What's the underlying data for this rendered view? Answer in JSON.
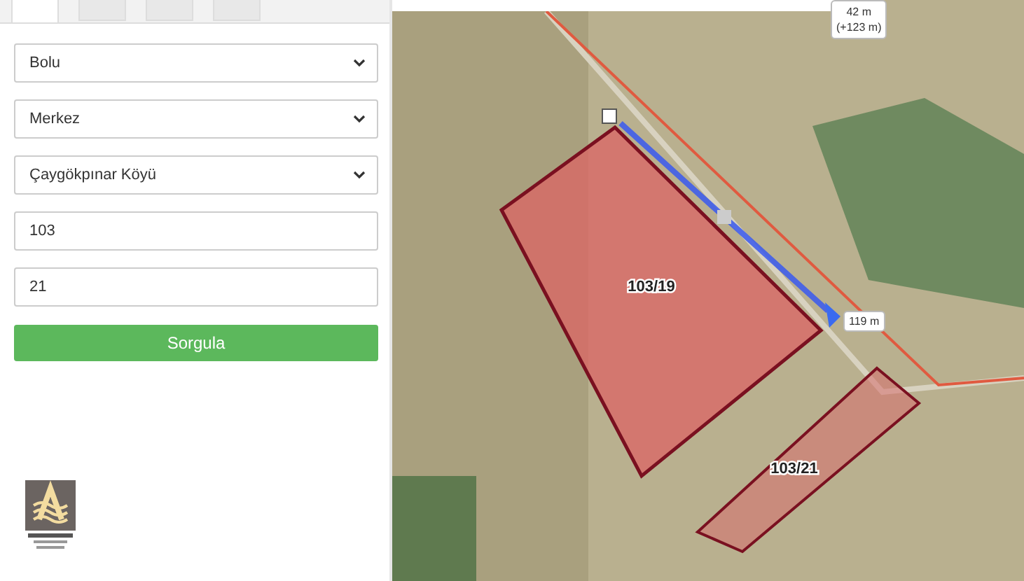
{
  "tabs": [
    {
      "selected": true
    },
    {
      "selected": false
    },
    {
      "selected": false
    },
    {
      "selected": false
    }
  ],
  "query_form": {
    "province": "Bolu",
    "district": "Merkez",
    "neighborhood": "Çaygökpınar Köyü",
    "block": "103",
    "parcel": "21",
    "button": "Sorgula"
  },
  "map": {
    "parcels": [
      {
        "label": "103/19",
        "selected": true
      },
      {
        "label": "103/21",
        "selected": false
      }
    ],
    "measure_label": "119 m",
    "distance_label": "42 m",
    "distance_delta": "(+123 m)"
  }
}
